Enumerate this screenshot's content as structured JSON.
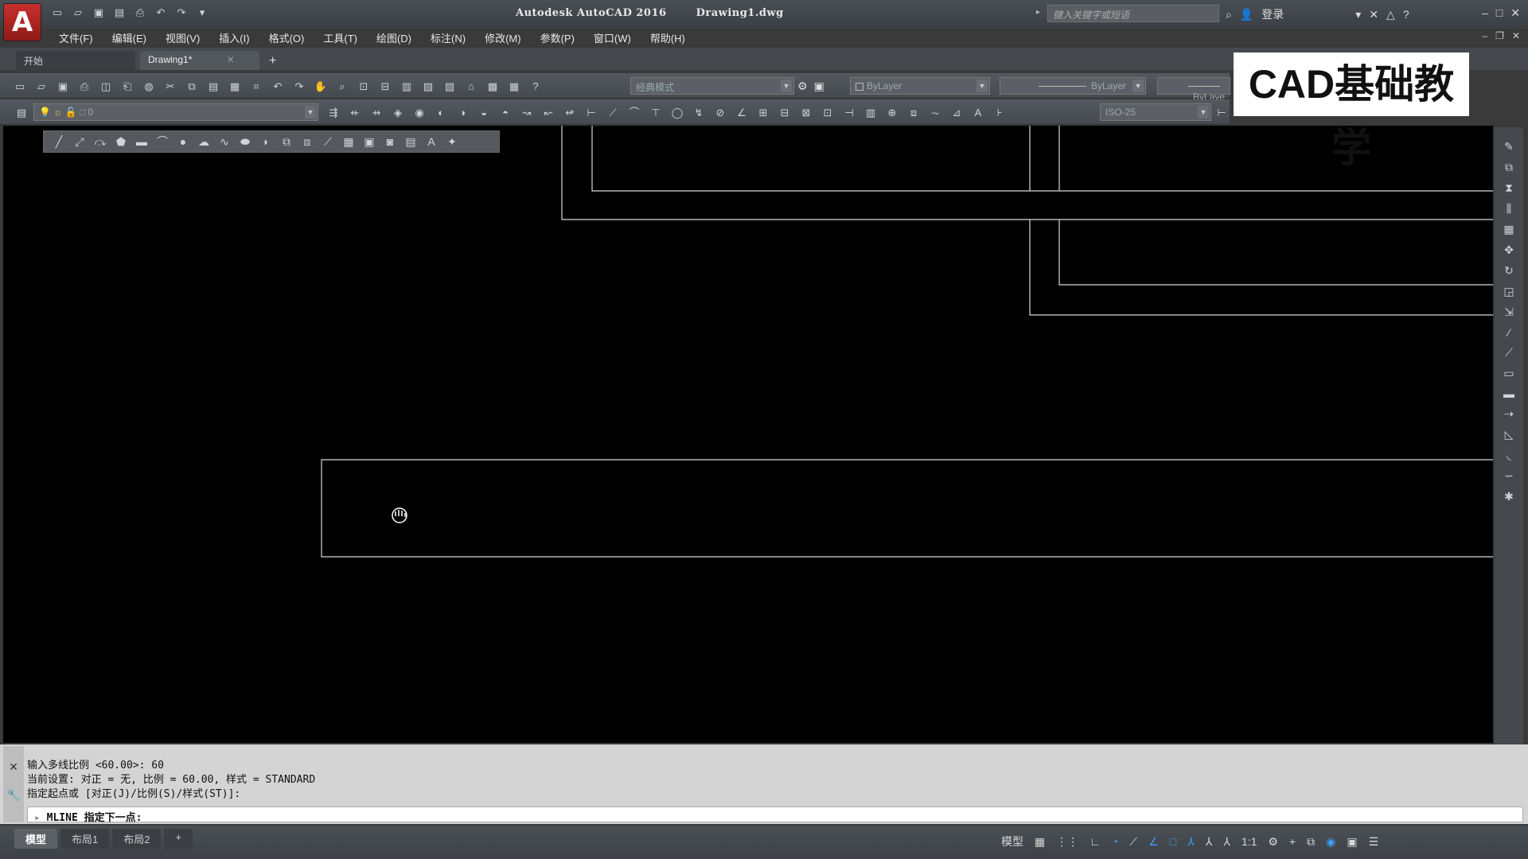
{
  "app": {
    "title": "Autodesk AutoCAD 2016",
    "document": "Drawing1.dwg",
    "search_placeholder": "键入关键字或短语",
    "login_label": "登录",
    "logo_glyph": "A"
  },
  "menu": [
    "文件(F)",
    "编辑(E)",
    "视图(V)",
    "插入(I)",
    "格式(O)",
    "工具(T)",
    "绘图(D)",
    "标注(N)",
    "修改(M)",
    "参数(P)",
    "窗口(W)",
    "帮助(H)"
  ],
  "tabs": [
    {
      "label": "开始",
      "active": false
    },
    {
      "label": "Drawing1*",
      "active": true
    }
  ],
  "toolbar": {
    "workspace": "经典模式",
    "color": "ByLayer",
    "linetype": "ByLayer",
    "lineweight": "ByLaye",
    "layer": "0",
    "dimstyle": "ISO-25"
  },
  "watermark": "CAD基础教学",
  "command": {
    "history": [
      "输入多线比例 <60.00>:  60",
      "当前设置: 对正 = 无, 比例 = 60.00, 样式 = STANDARD",
      "指定起点或 [对正(J)/比例(S)/样式(ST)]:"
    ],
    "prompt": "MLINE 指定下一点:"
  },
  "layout_tabs": [
    {
      "label": "模型",
      "active": true
    },
    {
      "label": "布局1",
      "active": false
    },
    {
      "label": "布局2",
      "active": false
    }
  ],
  "status": {
    "model_label": "模型",
    "scale": "1:1"
  },
  "colors": {
    "canvas_bg": "#000000",
    "drawing_lines": "#d9d9d9",
    "accent_blue": "#3aa0ff",
    "logo_red": "#c9302c"
  }
}
